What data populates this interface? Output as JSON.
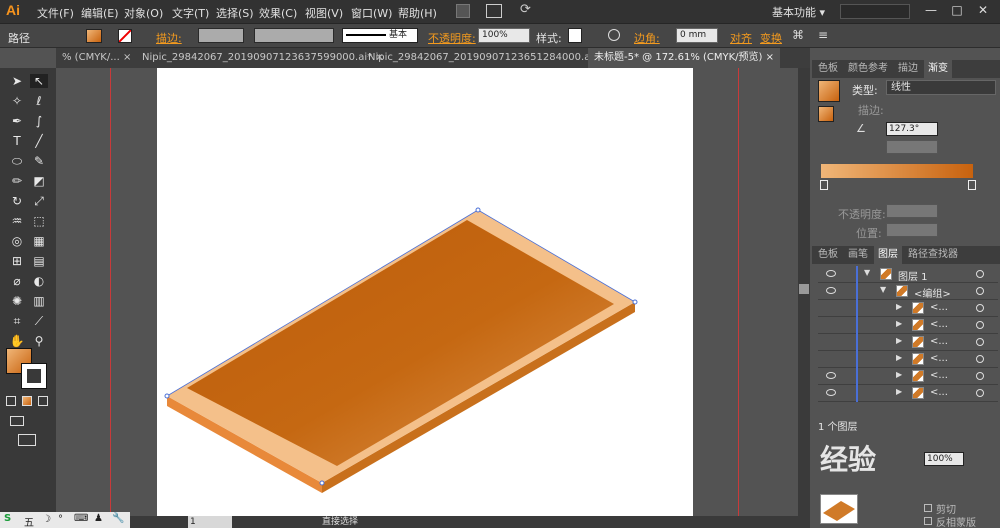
{
  "menubar": {
    "logo": "Ai",
    "items": [
      "文件(F)",
      "编辑(E)",
      "对象(O)",
      "文字(T)",
      "选择(S)",
      "效果(C)",
      "视图(V)",
      "窗口(W)",
      "帮助(H)"
    ],
    "workspace": "基本功能",
    "workspace_arrow": "▾",
    "minimize": "—",
    "maximize": "□",
    "close": "✕"
  },
  "control": {
    "path_label": "路径",
    "stroke_label": "描边:",
    "stroke_style": "基本",
    "opacity_label": "不透明度:",
    "opacity_value": "100%",
    "style_label": "样式:",
    "corner_label": "边角:",
    "corner_value": "0 mm",
    "align_label": "对齐",
    "transform_label": "变换"
  },
  "tabs": [
    "% (CMYK/...",
    "Nipic_29842067_20190907123637599000.ai*",
    "Nipic_29842067_20190907123651284000.ai*",
    "未标题-5* @ 172.61% (CMYK/预览)"
  ],
  "tab_close": "×",
  "gradient_panel": {
    "tabs": [
      "色板",
      "颜色参考",
      "描边",
      "渐变"
    ],
    "type_label": "类型:",
    "type_value": "线性",
    "stroke_label": "描边:",
    "angle_value": "127.3°",
    "opacity_label": "不透明度:",
    "position_label": "位置:",
    "stop_left_color": "#f0b678",
    "stop_right_color": "#c8620e"
  },
  "layers_panel": {
    "tabs": [
      "色板",
      "画笔",
      "图层",
      "路径查找器"
    ],
    "rows": [
      {
        "name": "图层 1",
        "indent": 0,
        "eye": true
      },
      {
        "name": "<编组>",
        "indent": 1,
        "eye": true
      },
      {
        "name": "<...",
        "indent": 2,
        "eye": false
      },
      {
        "name": "<...",
        "indent": 2,
        "eye": false
      },
      {
        "name": "<...",
        "indent": 2,
        "eye": false
      },
      {
        "name": "<...",
        "indent": 2,
        "eye": false
      },
      {
        "name": "<...",
        "indent": 2,
        "eye": true
      },
      {
        "name": "<...",
        "indent": 2,
        "eye": true
      }
    ],
    "footer_count": "1 个图层"
  },
  "transparency_panel": {
    "opacity_value": "100%",
    "clip_label": "剪切",
    "invert_mask_label": "反相蒙版"
  },
  "status": {
    "zoom": "172.61%",
    "page": "1",
    "tool_name": "直接选择"
  },
  "watermark": "经验",
  "colors": {
    "accent": "#f39a1e",
    "board_top_light": "#e0964e",
    "board_top_dark": "#bd5c0b",
    "board_border": "#f4c08a",
    "board_side": "#c8701c"
  },
  "taskbar": {
    "items": [
      "S",
      "五",
      "☽",
      "°",
      "⌨",
      "♟",
      "🔧"
    ]
  }
}
